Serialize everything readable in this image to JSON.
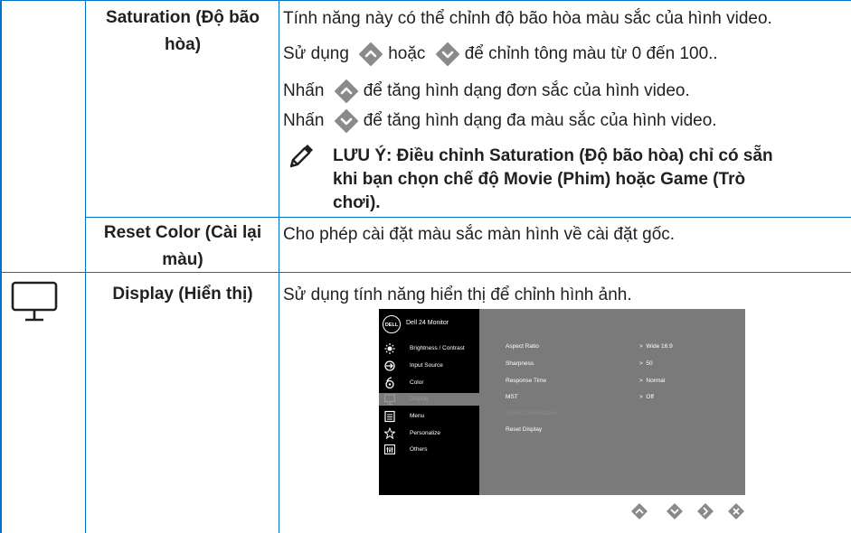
{
  "rows": {
    "saturation": {
      "label_line1": "Saturation (Độ bão",
      "label_line2": "hòa)",
      "line1": "Tính năng này có thể chỉnh độ bão hòa màu sắc của hình video.",
      "line2_pre": "Sử dụng",
      "line2_mid": "hoặc",
      "line2_post": "để chỉnh tông màu từ 0 đến 100..",
      "line3_pre": "Nhấn",
      "line3_post": "để tăng hình dạng đơn sắc của hình video.",
      "line4_pre": "Nhấn",
      "line4_post": "để tăng hình dạng đa màu sắc của hình video.",
      "note_line1": "LƯU Ý: Điều chỉnh Saturation (Độ bão hòa) chỉ có sẵn",
      "note_line2": "khi bạn chọn chế độ Movie (Phim) hoặc Game (Trò",
      "note_line3": "chơi)."
    },
    "reset_color": {
      "label_line1": "Reset Color (Cài lại",
      "label_line2": "màu)",
      "desc": "Cho phép cài đặt màu sắc màn hình về cài đặt gốc."
    },
    "display": {
      "icon": "monitor-icon",
      "label": "Display (Hiển thị)",
      "desc": "Sử dụng tính năng hiển thị để chỉnh hình ảnh."
    }
  },
  "osd": {
    "logo": "DELL",
    "title": "Dell 24 Monitor",
    "menu": [
      {
        "label": "Brightness / Contrast",
        "icon": "brightness-icon"
      },
      {
        "label": "Input Source",
        "icon": "input-source-icon"
      },
      {
        "label": "Color",
        "icon": "color-icon"
      },
      {
        "label": "Display",
        "icon": "display-icon"
      },
      {
        "label": "Menu",
        "icon": "menu-icon"
      },
      {
        "label": "Personalize",
        "icon": "star-icon"
      },
      {
        "label": "Others",
        "icon": "others-icon"
      }
    ],
    "options": [
      {
        "label": "Aspect Ratio",
        "value": "Wide 16:9"
      },
      {
        "label": "Sharpness",
        "value": "50"
      },
      {
        "label": "Response Time",
        "value": "Normal"
      },
      {
        "label": "MST",
        "value": "Off"
      },
      {
        "label": "USB-C Prioritization",
        "value": ""
      },
      {
        "label": "Reset Display",
        "value": ""
      }
    ],
    "nav_buttons": [
      "up-arrow-button",
      "down-arrow-button",
      "right-arrow-button",
      "close-button"
    ]
  },
  "colors": {
    "border": "#0072c6",
    "button": "#8a8a8a",
    "osd_bg": "#7a7a7a"
  }
}
